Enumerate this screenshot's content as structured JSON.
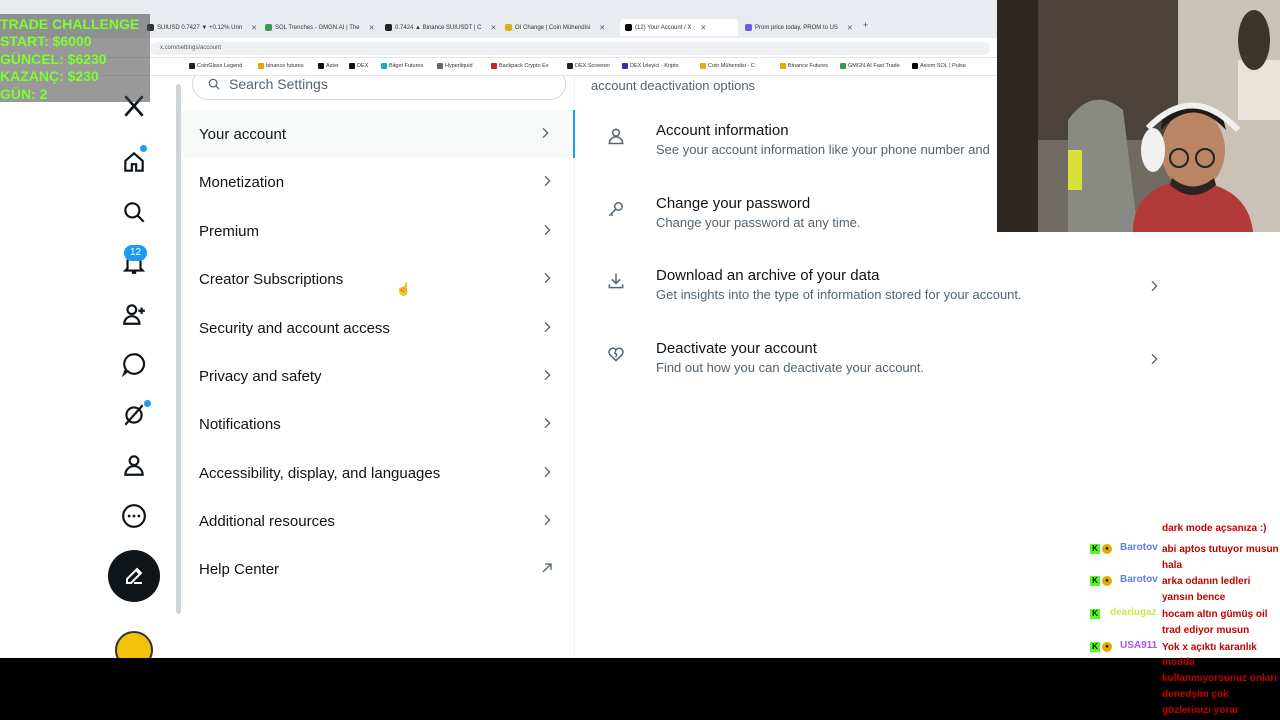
{
  "browser": {
    "tabs": [
      {
        "label": "SUIUSD 0.7427 ▼ +0.12% Unn",
        "active": false
      },
      {
        "label": "SOL Trenches - GMGN.AI | The",
        "active": false
      },
      {
        "label": "0.7424 ▲ Binance SUIUSDT | C",
        "active": false
      },
      {
        "label": "OI Change | Coin Mühendisi",
        "active": false
      },
      {
        "label": "(12) Your Account / X",
        "active": true
      },
      {
        "label": "Prom price today, PROM to US",
        "active": false
      }
    ],
    "new_tab": "+",
    "url": "x.com/settings/account",
    "bookmarks": [
      "CoinGlass Legend",
      "binance futures",
      "Aster",
      "DEX",
      "Bitget Futures",
      "Hyperliquid",
      "Backpack Crypto Ex",
      "DEX Screener",
      "DEX İzleyici - Kripto",
      "Coin Mühendisi - C",
      "Binance Futures",
      "GMGN.AI Fast Trade",
      "Axiom SOL | Pulse"
    ]
  },
  "nav": {
    "notifications_count": "12"
  },
  "settings": {
    "search_placeholder": "Search Settings",
    "items": [
      {
        "label": "Your account",
        "active": true
      },
      {
        "label": "Monetization"
      },
      {
        "label": "Premium"
      },
      {
        "label": "Creator Subscriptions"
      },
      {
        "label": "Security and account access"
      },
      {
        "label": "Privacy and safety"
      },
      {
        "label": "Notifications"
      },
      {
        "label": "Accessibility, display, and languages"
      },
      {
        "label": "Additional resources"
      },
      {
        "label": "Help Center",
        "external": true
      }
    ]
  },
  "detail": {
    "header_text": "account deactivation options",
    "rows": [
      {
        "title": "Account information",
        "desc": "See your account information like your phone number and",
        "icon": "person-icon"
      },
      {
        "title": "Change your password",
        "desc": "Change your password at any time.",
        "icon": "key-icon"
      },
      {
        "title": "Download an archive of your data",
        "desc": "Get insights into the type of information stored for your account.",
        "icon": "download-icon"
      },
      {
        "title": "Deactivate your account",
        "desc": "Find out how you can deactivate your account.",
        "icon": "broken-heart-icon"
      }
    ]
  },
  "overlay": {
    "title": "TRADE CHALLENGE",
    "start": "START: $6000",
    "current": "GÜNCEL: $6230",
    "profit": "KAZANÇ: $230",
    "day": "GÜN: 2",
    "text_color": "#7cff2e"
  },
  "chat": {
    "top_text": "dark mode açsanıza :)",
    "messages": [
      {
        "user": "Barotov",
        "text": "abi aptos tutuyor musun hala",
        "color": "#5b7fd8"
      },
      {
        "user": "Barotov",
        "text": "arka odanın ledleri yansın bence",
        "color": "#5b7fd8"
      },
      {
        "user": "dearlugaz",
        "text": "hocam altın gümüş oil trad ediyor musun",
        "color": "#c8e84a"
      },
      {
        "user": "USA911",
        "text": "Yok x açıktı karanlık",
        "color": "#a855f7"
      }
    ],
    "faded_text": "modda kullanmıyorsunuz onları denedşim çok gözlerinizi yorar"
  }
}
